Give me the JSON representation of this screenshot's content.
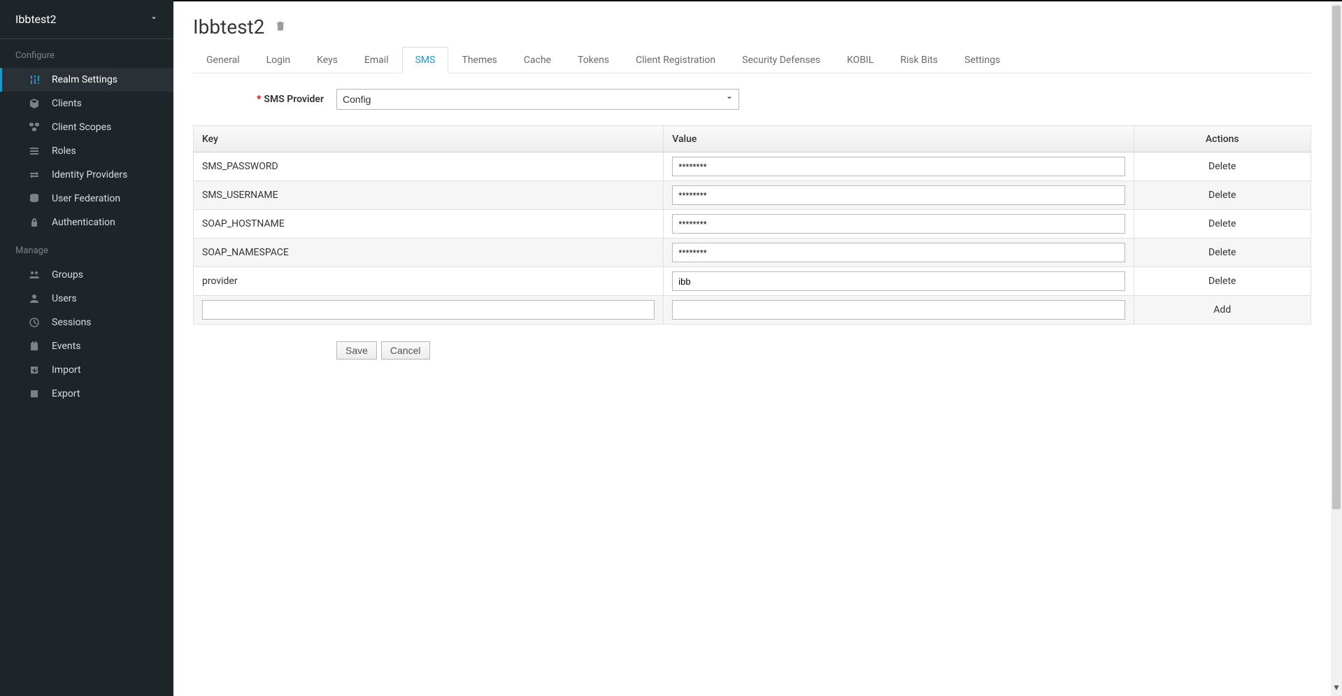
{
  "realm": {
    "name": "Ibbtest2"
  },
  "sidebar": {
    "configure_title": "Configure",
    "manage_title": "Manage",
    "configure": [
      {
        "label": "Realm Settings",
        "icon": "sliders",
        "active": true
      },
      {
        "label": "Clients",
        "icon": "cube"
      },
      {
        "label": "Client Scopes",
        "icon": "cubes"
      },
      {
        "label": "Roles",
        "icon": "list"
      },
      {
        "label": "Identity Providers",
        "icon": "exchange"
      },
      {
        "label": "User Federation",
        "icon": "database"
      },
      {
        "label": "Authentication",
        "icon": "lock"
      }
    ],
    "manage": [
      {
        "label": "Groups",
        "icon": "users-group"
      },
      {
        "label": "Users",
        "icon": "user"
      },
      {
        "label": "Sessions",
        "icon": "clock"
      },
      {
        "label": "Events",
        "icon": "calendar"
      },
      {
        "label": "Import",
        "icon": "import"
      },
      {
        "label": "Export",
        "icon": "export"
      }
    ]
  },
  "page": {
    "title": "Ibbtest2"
  },
  "tabs": [
    {
      "label": "General"
    },
    {
      "label": "Login"
    },
    {
      "label": "Keys"
    },
    {
      "label": "Email"
    },
    {
      "label": "SMS",
      "active": true
    },
    {
      "label": "Themes"
    },
    {
      "label": "Cache"
    },
    {
      "label": "Tokens"
    },
    {
      "label": "Client Registration"
    },
    {
      "label": "Security Defenses"
    },
    {
      "label": "KOBIL"
    },
    {
      "label": "Risk Bits"
    },
    {
      "label": "Settings"
    }
  ],
  "form": {
    "sms_provider": {
      "label": "SMS Provider",
      "value": "Config",
      "required": true
    }
  },
  "table": {
    "headers": {
      "key": "Key",
      "value": "Value",
      "actions": "Actions"
    },
    "rows": [
      {
        "key": "SMS_PASSWORD",
        "value": "********",
        "action": "Delete"
      },
      {
        "key": "SMS_USERNAME",
        "value": "********",
        "action": "Delete"
      },
      {
        "key": "SOAP_HOSTNAME",
        "value": "********",
        "action": "Delete"
      },
      {
        "key": "SOAP_NAMESPACE",
        "value": "********",
        "action": "Delete"
      },
      {
        "key": "provider",
        "value": "ibb",
        "action": "Delete"
      }
    ],
    "new_row": {
      "key": "",
      "value": "",
      "action": "Add"
    }
  },
  "buttons": {
    "save": "Save",
    "cancel": "Cancel"
  }
}
